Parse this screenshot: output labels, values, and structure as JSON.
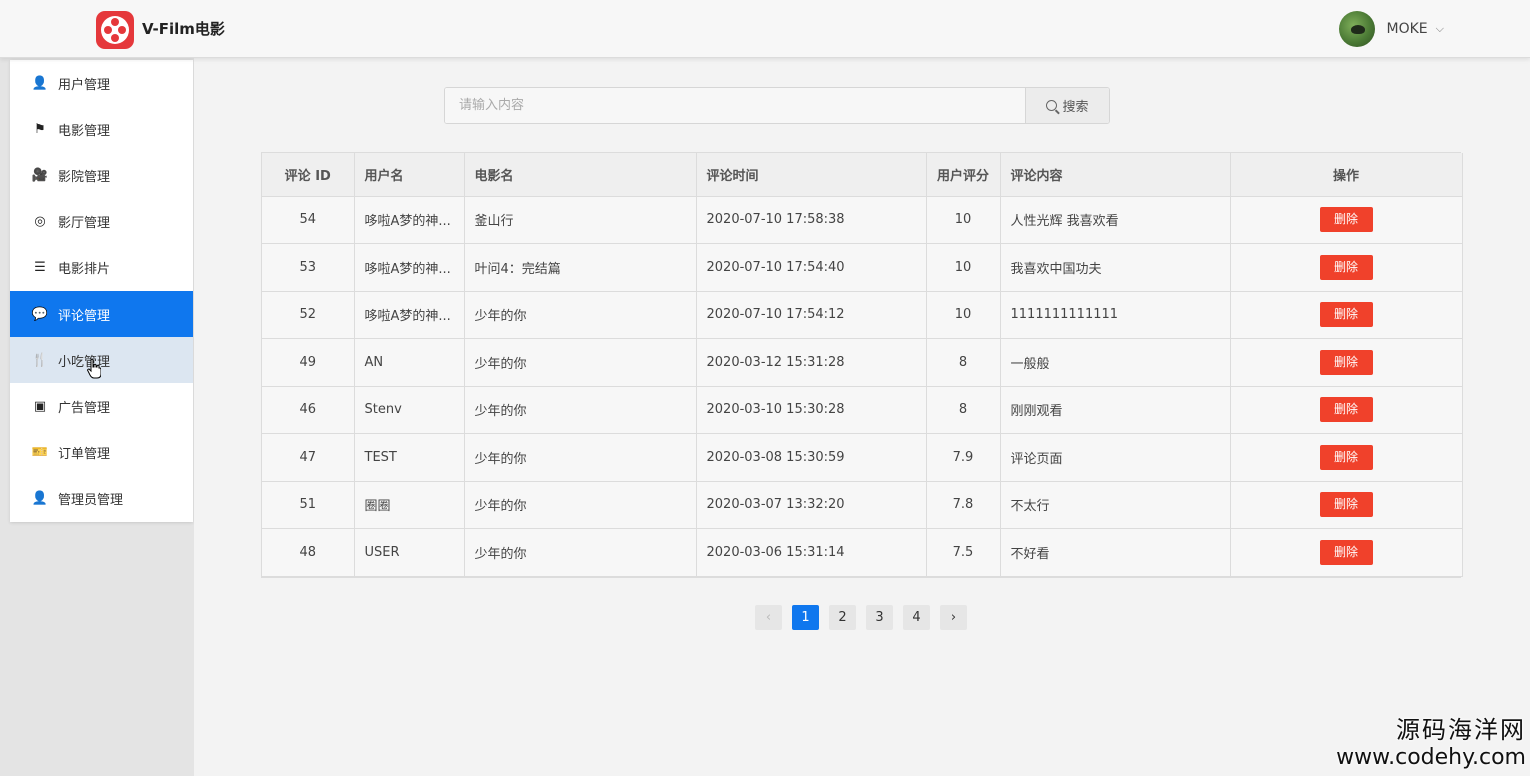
{
  "header": {
    "brand": "V-Film电影",
    "user": {
      "name": "MOKE",
      "chevron": "⌵"
    }
  },
  "sidebar": {
    "items": [
      {
        "label": "用户管理",
        "icon": "user-icon",
        "glyph": "👤"
      },
      {
        "label": "电影管理",
        "icon": "flag-icon",
        "glyph": "⚑"
      },
      {
        "label": "影院管理",
        "icon": "video-camera-icon",
        "glyph": "🎥"
      },
      {
        "label": "影厅管理",
        "icon": "lifebuoy-icon",
        "glyph": "◎"
      },
      {
        "label": "电影排片",
        "icon": "list-icon",
        "glyph": "☰"
      },
      {
        "label": "评论管理",
        "icon": "comment-icon",
        "glyph": "💬"
      },
      {
        "label": "小吃管理",
        "icon": "utensils-icon",
        "glyph": "🍴"
      },
      {
        "label": "广告管理",
        "icon": "ad-icon",
        "glyph": "▣"
      },
      {
        "label": "订单管理",
        "icon": "ticket-icon",
        "glyph": "🎫"
      },
      {
        "label": "管理员管理",
        "icon": "admin-icon",
        "glyph": "👤"
      }
    ],
    "active_index": 5,
    "hover_index": 6
  },
  "search": {
    "placeholder": "请输入内容",
    "value": "",
    "button_label": "搜索"
  },
  "table": {
    "columns": [
      "评论 ID",
      "用户名",
      "电影名",
      "评论时间",
      "用户评分",
      "评论内容",
      "操作"
    ],
    "rows": [
      {
        "id": "54",
        "user": "哆啦A梦的神...",
        "movie": "釜山行",
        "time": "2020-07-10 17:58:38",
        "score": "10",
        "content": "人性光辉 我喜欢看"
      },
      {
        "id": "53",
        "user": "哆啦A梦的神...",
        "movie": "叶问4：完结篇",
        "time": "2020-07-10 17:54:40",
        "score": "10",
        "content": "我喜欢中国功夫"
      },
      {
        "id": "52",
        "user": "哆啦A梦的神...",
        "movie": "少年的你",
        "time": "2020-07-10 17:54:12",
        "score": "10",
        "content": "1111111111111"
      },
      {
        "id": "49",
        "user": "AN",
        "movie": "少年的你",
        "time": "2020-03-12 15:31:28",
        "score": "8",
        "content": "一般般"
      },
      {
        "id": "46",
        "user": "Stenv",
        "movie": "少年的你",
        "time": "2020-03-10 15:30:28",
        "score": "8",
        "content": "刚刚观看"
      },
      {
        "id": "47",
        "user": "TEST",
        "movie": "少年的你",
        "time": "2020-03-08 15:30:59",
        "score": "7.9",
        "content": "评论页面"
      },
      {
        "id": "51",
        "user": "圈圈",
        "movie": "少年的你",
        "time": "2020-03-07 13:32:20",
        "score": "7.8",
        "content": "不太行"
      },
      {
        "id": "48",
        "user": "USER",
        "movie": "少年的你",
        "time": "2020-03-06 15:31:14",
        "score": "7.5",
        "content": "不好看"
      }
    ],
    "delete_label": "删除"
  },
  "pagination": {
    "prev": "‹",
    "next": "›",
    "pages": [
      "1",
      "2",
      "3",
      "4"
    ],
    "current": "1"
  },
  "watermark": {
    "line1": "源码海洋网",
    "line2": "www.codehy.com"
  },
  "colors": {
    "accent": "#0f77ee",
    "danger": "#f0412b",
    "logo": "#e5383b"
  }
}
